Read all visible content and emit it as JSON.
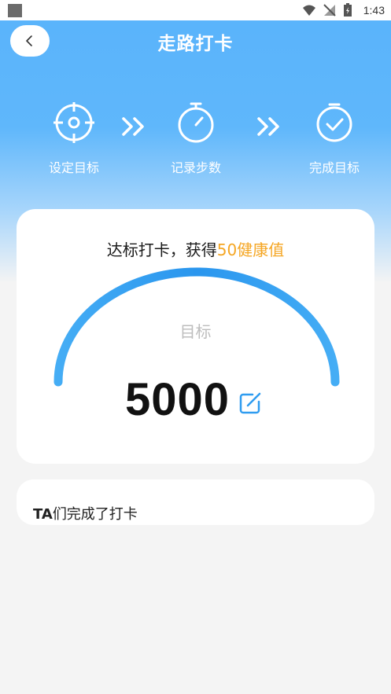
{
  "statusbar": {
    "time": "1:43"
  },
  "header": {
    "title": "走路打卡"
  },
  "steps": [
    {
      "label": "设定目标",
      "icon": "target-icon"
    },
    {
      "label": "记录步数",
      "icon": "stopwatch-icon"
    },
    {
      "label": "完成目标",
      "icon": "check-circle-icon"
    }
  ],
  "reward": {
    "prefix": "达标打卡，获得",
    "highlight": "50健康值"
  },
  "goal": {
    "label": "目标",
    "value": "5000"
  },
  "checkins": {
    "title_strong": "TA",
    "title_rest": "们完成了打卡"
  },
  "colors": {
    "primary": "#59b3fb",
    "accent": "#f5a623",
    "gauge": "#2f9cf0"
  }
}
